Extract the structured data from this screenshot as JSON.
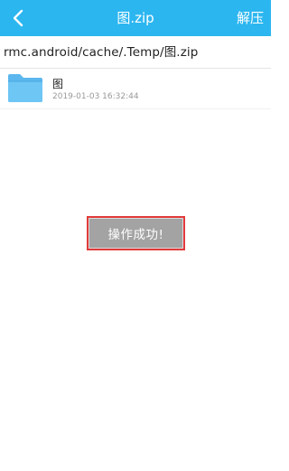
{
  "header": {
    "back_icon": "chevron-left-icon",
    "title": "图.zip",
    "action_label": "解压",
    "background_color": "#2bb6f0"
  },
  "path_bar": {
    "path": "rmc.android/cache/.Temp/图.zip"
  },
  "files": [
    {
      "icon": "folder-icon",
      "name": "图",
      "date": "2019-01-03 16:32:44"
    }
  ],
  "toast": {
    "message": "操作成功!",
    "border_color": "#e23a3a"
  }
}
